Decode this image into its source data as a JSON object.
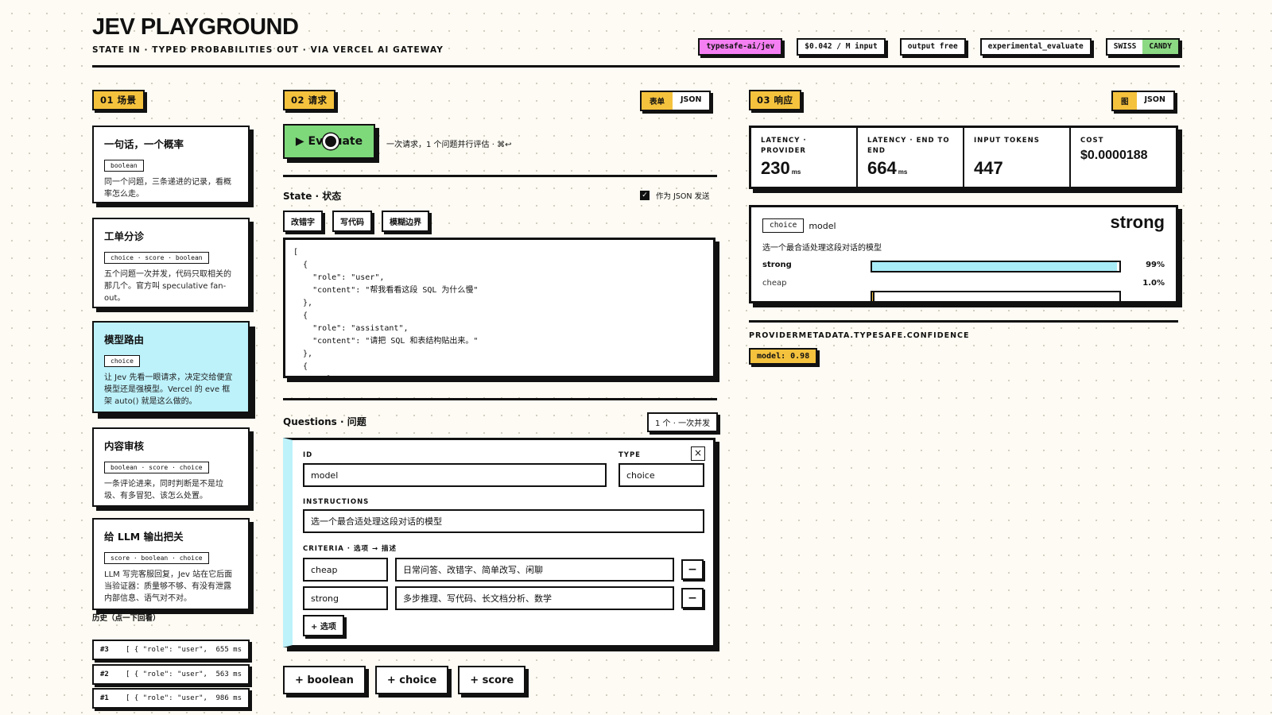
{
  "header": {
    "title": "JEV PLAYGROUND",
    "subtitle": "STATE IN · TYPED PROBABILITIES OUT · VIA VERCEL AI GATEWAY",
    "badges": {
      "repo": "typesafe-ai/jev",
      "price_input": "$0.042 / M input",
      "price_output": "output free",
      "mode": "experimental_evaluate"
    },
    "theme_toggle": {
      "left": "SWISS",
      "right": "CANDY",
      "active": "CANDY"
    }
  },
  "scenarios": {
    "section_label": "01 场景",
    "items": [
      {
        "title": "一句话，一个概率",
        "types": "boolean",
        "desc": "同一个问题，三条递进的记录，看概率怎么走。"
      },
      {
        "title": "工单分诊",
        "types": "choice · score · boolean",
        "desc": "五个问题一次并发，代码只取相关的那几个。官方叫 speculative fan-out。"
      },
      {
        "title": "模型路由",
        "types": "choice",
        "desc": "让 Jev 先看一眼请求，决定交给便宜模型还是强模型。Vercel 的 eve 框架 auto() 就是这么做的。",
        "active": true
      },
      {
        "title": "内容审核",
        "types": "boolean · score · choice",
        "desc": "一条评论进来，同时判断是不是垃圾、有多冒犯、该怎么处置。"
      },
      {
        "title": "给 LLM 输出把关",
        "types": "score · boolean · choice",
        "desc": "LLM 写完客服回复，Jev 站在它后面当验证器：质量够不够、有没有泄露内部信息、语气对不对。"
      }
    ],
    "history_label": "历史（点一下回看）",
    "history": [
      {
        "id": "#3",
        "text": "[ { \"role\": \"user\", \"...",
        "ms": "655 ms"
      },
      {
        "id": "#2",
        "text": "[ { \"role\": \"user\", \"...",
        "ms": "563 ms"
      },
      {
        "id": "#1",
        "text": "[ { \"role\": \"user\", \"...",
        "ms": "986 ms"
      }
    ]
  },
  "request": {
    "section_label": "02 请求",
    "view_toggle": {
      "form": "表单",
      "json": "JSON"
    },
    "evaluate_label": "▶ Evaluate",
    "evaluate_hint": "一次请求，1 个问题并行评估 · ⌘↩",
    "state_label": "State · 状态",
    "send_as_json_label": "作为 JSON 发送",
    "presets": [
      "改错字",
      "写代码",
      "模糊边界"
    ],
    "state_text": "[\n  {\n    \"role\": \"user\",\n    \"content\": \"帮我看看这段 SQL 为什么慢\"\n  },\n  {\n    \"role\": \"assistant\",\n    \"content\": \"请把 SQL 和表结构贴出来。\"\n  },\n  {\n    \"role\": \"user\",",
    "questions_label": "Questions · 问题",
    "questions_count": "1 个 · 一次并发",
    "question": {
      "id_label": "ID",
      "type_label": "TYPE",
      "id_value": "model",
      "type_value": "choice",
      "instructions_label": "INSTRUCTIONS",
      "instructions_value": "选一个最合适处理这段对话的模型",
      "criteria_label": "CRITERIA · 选项 → 描述",
      "criteria": [
        {
          "option": "cheap",
          "desc": "日常问答、改错字、简单改写、闲聊"
        },
        {
          "option": "strong",
          "desc": "多步推理、写代码、长文档分析、数学"
        }
      ],
      "add_option_label": "+ 选项",
      "close_label": "×",
      "remove_label": "−"
    },
    "add_buttons": [
      "+ boolean",
      "+ choice",
      "+ score"
    ]
  },
  "response": {
    "section_label": "03 响应",
    "view_toggle": {
      "chart": "图",
      "json": "JSON"
    },
    "metrics": [
      {
        "label": "LATENCY · PROVIDER",
        "value": "230",
        "unit": "ms"
      },
      {
        "label": "LATENCY · END TO END",
        "value": "664",
        "unit": "ms"
      },
      {
        "label": "INPUT TOKENS",
        "value": "447",
        "unit": ""
      },
      {
        "label": "COST",
        "value": "$0.0000188",
        "unit": ""
      }
    ],
    "result": {
      "type_badge": "choice",
      "id": "model",
      "winner": "strong",
      "instructions": "选一个最合适处理这段对话的模型",
      "options": [
        {
          "label": "strong",
          "percent_text": "99%",
          "fraction": 0.99,
          "color": "#a8ecf8"
        },
        {
          "label": "cheap",
          "percent_text": "1.0%",
          "fraction": 0.01,
          "color": "#f5c23d"
        }
      ]
    },
    "confidence_label": "PROVIDERMETADATA.TYPESAFE.CONFIDENCE",
    "confidence_value": "model: 0.98"
  },
  "colors": {
    "accent_yellow": "#f5c23d",
    "accent_green": "#7ed97a",
    "accent_cyan": "#bdf2fb",
    "accent_pink": "#f47ff2",
    "ink": "#111111",
    "paper": "#fdfbf3"
  }
}
